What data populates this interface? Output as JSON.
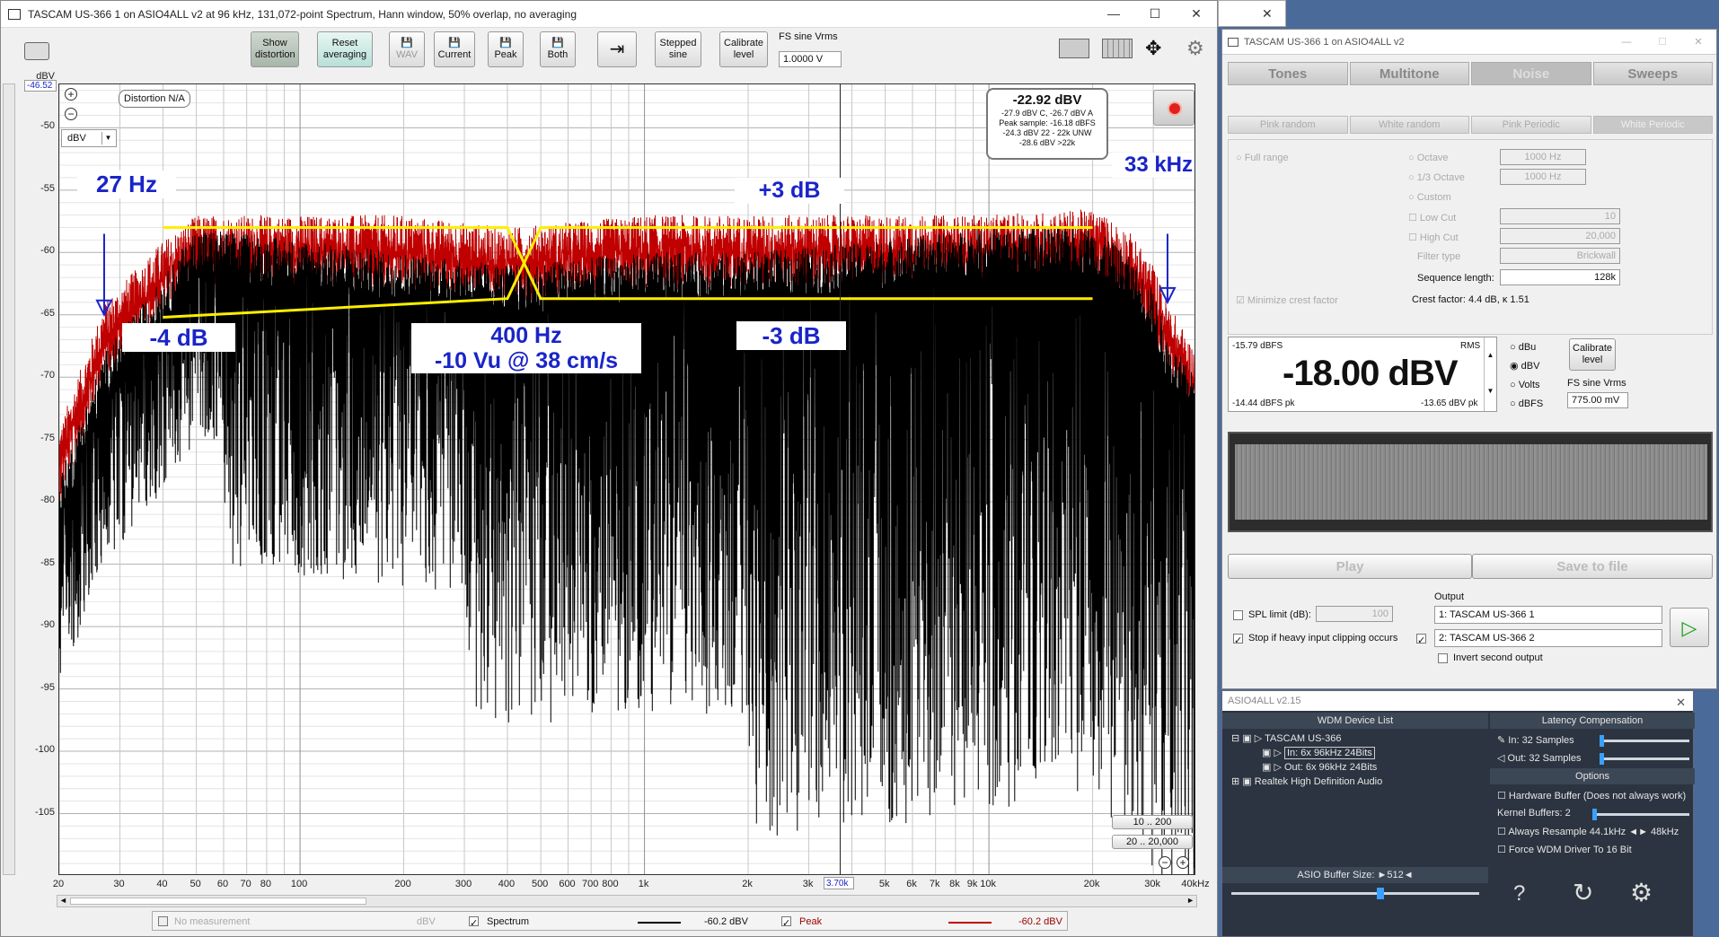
{
  "main_window": {
    "title": "TASCAM US-366 1 on ASIO4ALL v2 at 96 kHz, 131,072-point Spectrum, Hann window, 50% overlap, no averaging",
    "toolbar": {
      "show_distortion": "Show distortion",
      "reset_averaging": "Reset averaging",
      "wav": "WAV",
      "current": "Current",
      "peak": "Peak",
      "both": "Both",
      "stepped_sine": "Stepped sine",
      "calibrate_level": "Calibrate level",
      "fs_sine_label": "FS sine Vrms",
      "fs_sine_value": "1.0000 V"
    },
    "plot": {
      "y_unit": "dBV",
      "y_readout": "-46.52",
      "distortion_label": "Distortion N/A",
      "unit_select": "dBV",
      "info_box": {
        "main": "-22.92 dBV",
        "line1": "-27.9 dBV C, -26.7 dBV A",
        "line2": "Peak sample: -16.18 dBFS",
        "line3": "-24.3 dBV 22 - 22k UNW",
        "line4": "-28.6 dBV >22k"
      },
      "range_buttons": [
        "10 .. 200",
        "20 .. 20,000"
      ],
      "cursor_readout": "3.70k"
    },
    "annotations": {
      "hz27": "27 Hz",
      "khz33": "33 kHz",
      "plus3": "+3 dB",
      "minus4": "-4 dB",
      "hz400": "400 Hz",
      "vu": "-10 Vu @ 38 cm/s",
      "minus3": "-3 dB"
    },
    "legend": {
      "no_measurement": "No measurement",
      "no_measurement_unit": "dBV",
      "spectrum": "Spectrum",
      "spectrum_value": "-60.2 dBV",
      "peak": "Peak",
      "peak_value": "-60.2 dBV"
    }
  },
  "chart_data": {
    "type": "line",
    "x_scale": "log",
    "xlim": [
      20,
      40000
    ],
    "ylim": [
      -110,
      -46.52
    ],
    "ylabel": "dBV",
    "y_ticks": [
      -50,
      -55,
      -60,
      -65,
      -70,
      -75,
      -80,
      -85,
      -90,
      -95,
      -100,
      -105
    ],
    "x_ticks": [
      {
        "v": 20,
        "l": "20"
      },
      {
        "v": 30,
        "l": "30"
      },
      {
        "v": 40,
        "l": "40"
      },
      {
        "v": 50,
        "l": "50"
      },
      {
        "v": 60,
        "l": "60"
      },
      {
        "v": 70,
        "l": "70"
      },
      {
        "v": 80,
        "l": "80"
      },
      {
        "v": 100,
        "l": "100"
      },
      {
        "v": 200,
        "l": "200"
      },
      {
        "v": 300,
        "l": "300"
      },
      {
        "v": 400,
        "l": "400"
      },
      {
        "v": 500,
        "l": "500"
      },
      {
        "v": 600,
        "l": "600"
      },
      {
        "v": 700,
        "l": "700"
      },
      {
        "v": 800,
        "l": "800"
      },
      {
        "v": 1000,
        "l": "1k"
      },
      {
        "v": 2000,
        "l": "2k"
      },
      {
        "v": 3000,
        "l": "3k"
      },
      {
        "v": 5000,
        "l": "5k"
      },
      {
        "v": 6000,
        "l": "6k"
      },
      {
        "v": 7000,
        "l": "7k"
      },
      {
        "v": 8000,
        "l": "8k"
      },
      {
        "v": 9000,
        "l": "9k"
      },
      {
        "v": 10000,
        "l": "10k"
      },
      {
        "v": 20000,
        "l": "20k"
      },
      {
        "v": 30000,
        "l": "30k"
      },
      {
        "v": 40000,
        "l": "40kHz"
      }
    ],
    "series": [
      {
        "name": "Peak",
        "color": "#c00000",
        "x": [
          20,
          27,
          40,
          50,
          100,
          200,
          400,
          1000,
          2000,
          5000,
          10000,
          20000,
          25000,
          30000,
          33000,
          40000
        ],
        "values": [
          -76,
          -66,
          -61,
          -59,
          -59,
          -59,
          -60,
          -59,
          -59,
          -59,
          -59,
          -58.5,
          -60,
          -63,
          -66,
          -70
        ]
      },
      {
        "name": "Spectrum",
        "color": "#000000",
        "x": [
          20,
          27,
          40,
          50,
          100,
          200,
          400,
          1000,
          2000,
          5000,
          10000,
          20000,
          25000,
          30000,
          33000,
          40000
        ],
        "values": [
          -80,
          -70,
          -64,
          -60,
          -61,
          -62,
          -63,
          -62,
          -62,
          -61,
          -60,
          -60,
          -62,
          -65,
          -69,
          -72
        ]
      }
    ],
    "reference_lines": [
      {
        "name": "+3 dB",
        "color": "#ffee00",
        "x": [
          40,
          400,
          500,
          20000
        ],
        "values": [
          -58,
          -58,
          -63.7,
          -63.7
        ]
      },
      {
        "name": "-3 dB",
        "color": "#ffee00",
        "x": [
          40,
          400,
          500,
          20000
        ],
        "values": [
          -65.2,
          -63.7,
          -58,
          -58
        ]
      }
    ]
  },
  "noise_panel": {
    "title": "TASCAM US-366 1 on ASIO4ALL v2",
    "tabs": [
      "Tones",
      "Multitone",
      "Noise",
      "Sweeps"
    ],
    "subtabs": [
      "Pink random",
      "White random",
      "Pink Periodic",
      "White Periodic"
    ],
    "full_range": "Full range",
    "octave": "Octave",
    "third_octave": "1/3 Octave",
    "custom": "Custom",
    "low_cut": "Low Cut",
    "high_cut": "High Cut",
    "filter_type": "Filter type",
    "filter_type_value": "Brickwall",
    "freq1": "1000 Hz",
    "freq2": "1000 Hz",
    "low_cut_value": "10",
    "high_cut_value": "20,000",
    "sequence_length_label": "Sequence length:",
    "sequence_length": "128k",
    "minimize_crest": "Minimize crest factor",
    "crest_factor": "Crest factor: 4.4 dB, κ 1.51",
    "level": {
      "dbfs_top": "-15.79 dBFS",
      "rms": "RMS",
      "main": "-18.00 dBV",
      "pk": "-14.44 dBFS pk",
      "pk2": "-13.65 dBV pk"
    },
    "units": [
      "dBu",
      "dBV",
      "Volts",
      "dBFS"
    ],
    "calibrate_level": "Calibrate level",
    "fs_sine_label": "FS sine Vrms",
    "fs_sine_value": "775.00 mV",
    "play": "Play",
    "save_to_file": "Save to file",
    "spl_limit": "SPL limit (dB):",
    "spl_value": "100",
    "stop_clipping": "Stop if heavy input clipping occurs",
    "output_label": "Output",
    "output1": "1: TASCAM US-366 1",
    "output2": "2: TASCAM US-366 2",
    "invert_second": "Invert second output"
  },
  "asio_panel": {
    "title": "ASIO4ALL v2.15",
    "device_list": "WDM Device List",
    "latency": "Latency Compensation",
    "device1": "TASCAM US-366",
    "in_channel": "In: 6x 96kHz 24Bits",
    "out_channel": "Out: 6x 96kHz 24Bits",
    "device2": "Realtek High Definition Audio",
    "latency_in": "In: 32 Samples",
    "latency_out": "Out: 32 Samples",
    "options": "Options",
    "hw_buffer": "Hardware Buffer (Does not always work)",
    "kernel_buffers": "Kernel Buffers: 2",
    "resample": "Always Resample 44.1kHz ◄► 48kHz",
    "force_wdm": "Force WDM Driver To 16 Bit",
    "buffer_size": "ASIO Buffer Size: ►512◄"
  }
}
